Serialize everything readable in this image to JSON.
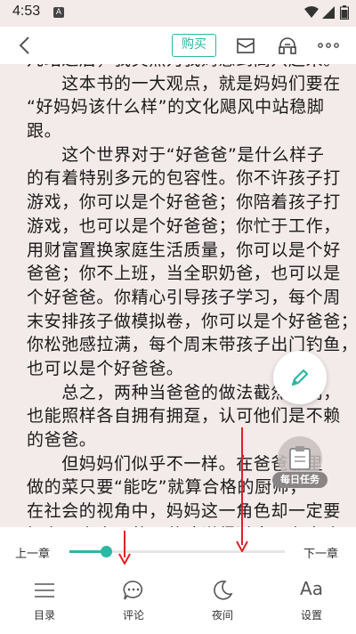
{
  "status_bar": {
    "time": "4:53",
    "notification_letter": "A"
  },
  "toolbar": {
    "buy_label": "购买",
    "accent_color": "#2bb8a4"
  },
  "content": {
    "lines": [
      "几站过后，我突然为我妈感到高兴起来。",
      "　　这本书的一大观点，就是妈妈们要在",
      "“好妈妈该什么样”的文化飓风中站稳脚",
      "跟。",
      "　　这个世界对于“好爸爸”是什么样子",
      "的有着特别多元的包容性。你不许孩子打",
      "游戏，你可以是个好爸爸；你陪着孩子打",
      "游戏，也可以是个好爸爸；你忙于工作，",
      "用财富置换家庭生活质量，你可以是个好",
      "爸爸；你不上班，当全职奶爸，也可以是",
      "个好爸爸。你精心引导孩子学习，每个周",
      "末安排孩子做模拟卷，你可以是个好爸爸；",
      "你松弛感拉满，每个周末带孩子出门钓鱼，",
      "也可以是个好爸爸。",
      "　　总之，两种当爸爸的做法截然不同，",
      "也能照样各自拥有拥趸，认可他们是不赖",
      "的爸爸。",
      "　　但妈妈们似乎不一样。在爸爸那里",
      "做的菜只要“能吃”就算合格的厨师，",
      "在社会的视角中，妈妈这一角色却一定要",
      "拥有更高水平的厨艺才说得过去。在春晚"
    ]
  },
  "daily_task": {
    "label": "每日任务"
  },
  "chapter_nav": {
    "prev_label": "上一章",
    "next_label": "下一章",
    "progress": 0.17
  },
  "menu": {
    "items": [
      {
        "label": "目录",
        "icon": "list-icon"
      },
      {
        "label": "评论",
        "icon": "comment-icon"
      },
      {
        "label": "夜间",
        "icon": "moon-icon"
      },
      {
        "label": "设置",
        "icon": "font-settings-icon",
        "glyph": "Aa"
      }
    ]
  },
  "annotations": {
    "arrow_color": "#e02020"
  }
}
